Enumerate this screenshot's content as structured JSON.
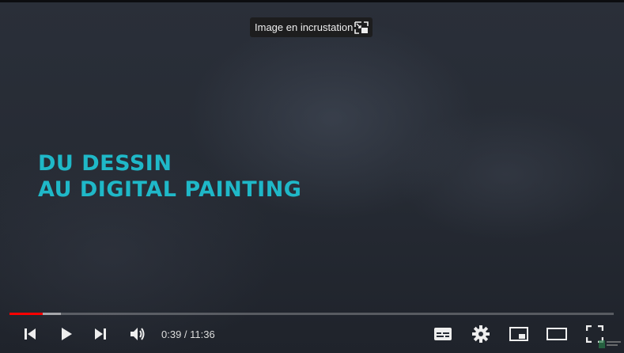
{
  "player": {
    "pip_tooltip": {
      "label": "Image en incrustation",
      "icon": "picture-in-picture-icon"
    },
    "title_lines": [
      "DU DESSIN",
      "AU DIGITAL PAINTING"
    ],
    "title_color": "#1fb8c8",
    "progress": {
      "played_fraction": 0.055,
      "buffered_fraction": 0.085,
      "played_color": "#ff0000"
    },
    "controls": {
      "previous": "previous-icon",
      "play": "play-icon",
      "next": "next-icon",
      "volume": "volume-icon",
      "subtitles": "subtitles-icon",
      "settings": "gear-icon",
      "miniplayer": "miniplayer-icon",
      "theater": "theater-mode-icon",
      "fullscreen": "fullscreen-icon"
    },
    "time_display": "0:39 / 11:36"
  }
}
